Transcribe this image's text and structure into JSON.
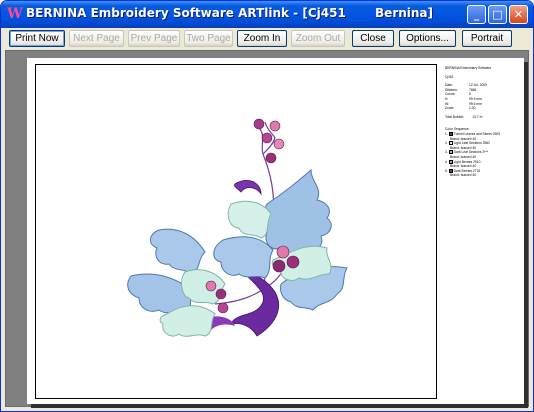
{
  "window": {
    "title": "BERNINA Embroidery Software ARTlink - [Cj451       Bernina]",
    "minimize_glyph": "_",
    "maximize_glyph": "□",
    "close_glyph": "✕"
  },
  "toolbar": {
    "print_now": "Print Now",
    "next_page": "Next Page",
    "prev_page": "Prev Page",
    "two_page": "Two Page",
    "zoom_in": "Zoom In",
    "zoom_out": "Zoom Out",
    "close": "Close",
    "options": "Options...",
    "portrait": "Portrait"
  },
  "info_panel": {
    "header": "BERNINA Embroidery Software",
    "design": "Cj451",
    "rows": [
      {
        "k": "Date:",
        "v": "12 Jul, 2009"
      },
      {
        "k": "Stitches:",
        "v": "7666"
      },
      {
        "k": "Colors:",
        "v": "5"
      },
      {
        "k": "H:",
        "v": "99.9 mm"
      },
      {
        "k": "W:",
        "v": "99.6 mm"
      },
      {
        "k": "Zoom:",
        "v": "1.00"
      }
    ],
    "total_bobbin": "Total Bobbin:         13.7 m",
    "color_sequence_title": "Color Sequence:",
    "colors": [
      {
        "n": "1.",
        "name": "Tunnel Leaves and Stems 0929",
        "brand": "Brand: Isacord 40",
        "hex": "#6a2a8c"
      },
      {
        "n": "2.",
        "name": "Light Leaf Sections 3962",
        "brand": "Brand: Isacord 40",
        "hex": "#cfeee5"
      },
      {
        "n": "3.",
        "name": "Dark Leaf Sections 3***",
        "brand": "Brand: Isacord 40",
        "hex": "#9ec3e8"
      },
      {
        "n": "4.",
        "name": "Light Berries 2910",
        "brand": "Brand: Isacord 40",
        "hex": "#e07aac"
      },
      {
        "n": "5.",
        "name": "Dark Berries 2715",
        "brand": "Brand: Isacord 40",
        "hex": "#8c2a6e"
      }
    ]
  }
}
